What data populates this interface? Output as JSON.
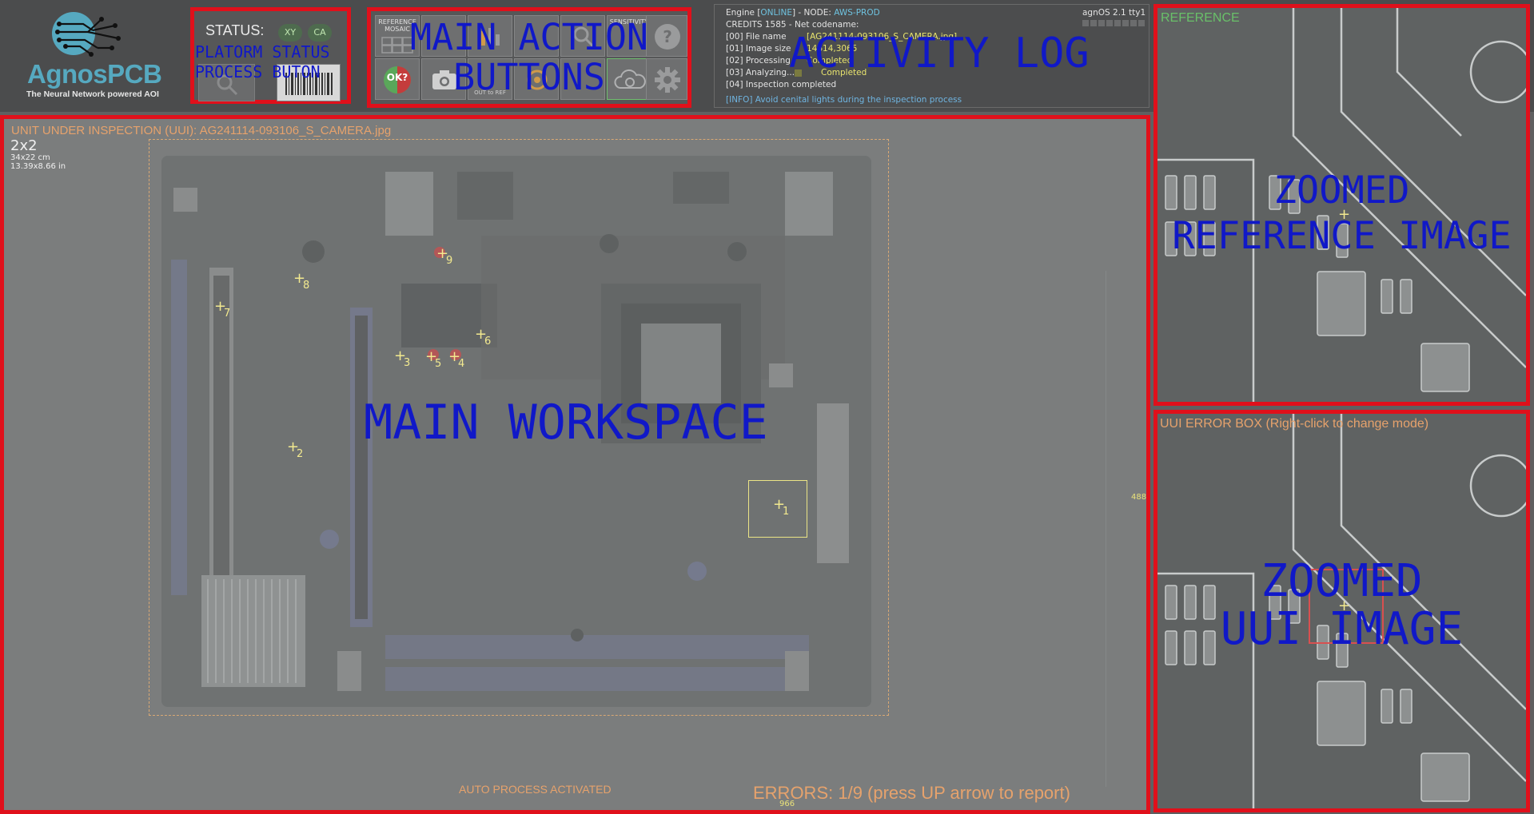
{
  "app": {
    "logo_title": "AgnosPCB",
    "logo_subtitle": "The Neural Network powered AOI"
  },
  "status": {
    "title": "STATUS:",
    "pill_xy": "XY",
    "pill_ca": "CA",
    "overlay_label_line1": "PLATORM STATUS",
    "overlay_label_line2": "PROCESS BUTON"
  },
  "actions": {
    "overlay_label_line1": "MAIN ACTION",
    "overlay_label_line2": "BUTTONS",
    "reference_mosaic_label": "REFERENCE MOSAIC",
    "sensitivity_label": "SENSITIVITY",
    "ok_label": "OK?",
    "out_to_ref_label": "OUT to REF",
    "help_icon": "question-icon",
    "settings_icon": "gear-icon",
    "camera_icon": "camera-icon"
  },
  "log": {
    "overlay_label": "ACTIVITY LOG",
    "engine_prefix": "Engine [",
    "engine_status": "ONLINE",
    "engine_node_prefix": "] - NODE: ",
    "engine_node": "AWS-PROD",
    "os_version": "agnOS 2.1 tty1",
    "credits_line": "CREDITS 1585 - Net codename:",
    "lines": [
      {
        "label": "[00] File name",
        "value": "[AG241114-093106_S_CAMERA.jpg]"
      },
      {
        "label": "[01] Image size",
        "value": "14614,3065"
      },
      {
        "label": "[02] Processing",
        "value": "Completed"
      },
      {
        "label": "[03] Analyzing...",
        "value": "Completed"
      },
      {
        "label": "[04] Inspection completed",
        "value": ""
      }
    ],
    "info_line": "[INFO] Avoid cenital lights during the inspection process"
  },
  "workspace": {
    "overlay_label": "MAIN WORKSPACE",
    "title": "UNIT UNDER INSPECTION (UUI): AG241114-093106_S_CAMERA.jpg",
    "grid_size": "2x2",
    "dims_cm": "34x22 cm",
    "dims_in": "13.39x8.66 in",
    "ruler_right": "488",
    "ruler_bottom": "966",
    "auto_process": "AUTO PROCESS ACTIVATED",
    "errors": "ERRORS: 1/9 (press UP arrow to report)",
    "markers": [
      "1",
      "2",
      "3",
      "4",
      "5",
      "6",
      "7",
      "8",
      "9"
    ]
  },
  "reference": {
    "title": "REFERENCE",
    "overlay_label_line1": "ZOOMED",
    "overlay_label_line2": "REFERENCE IMAGE"
  },
  "uui_zoom": {
    "title": "UUI ERROR BOX (Right-click to change mode)",
    "overlay_label_line1": "ZOOMED",
    "overlay_label_line2": "UUI IMAGE"
  },
  "colors": {
    "annotation_red": "#e0101b",
    "annotation_blue": "#1018c8",
    "brand": "#56a9c0",
    "accent_orange": "#e6a26c",
    "marker_yellow": "#f2e98f"
  }
}
